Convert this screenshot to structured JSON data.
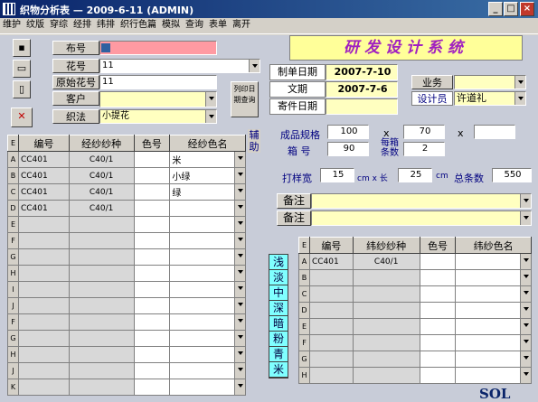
{
  "window": {
    "title": "织物分析表 — 2009-6-11 (ADMIN)"
  },
  "menu": [
    "维护",
    "纹版",
    "穿综",
    "经排",
    "纬排",
    "织行色篇",
    "模拟",
    "查询",
    "表单",
    "离开"
  ],
  "banner": "研发设计系统",
  "form": {
    "cloth_no_label": "布号",
    "cloth_no_value": "",
    "pattern_no_label": "花号",
    "pattern_no_value": "11",
    "orig_pattern_label": "原始花号",
    "orig_pattern_value": "11",
    "customer_label": "客户",
    "customer_value": "",
    "weave_label": "织法",
    "weave_value": "小提花",
    "print_btn": "列印日期查询",
    "make_date_label": "制单日期",
    "make_date_value": "2007-7-10",
    "doc_date_label": "文期",
    "doc_date_value": "2007-7-6",
    "send_date_label": "寄件日期",
    "send_date_value": "",
    "business_label": "业务",
    "business_value": "",
    "designer_label": "设计员",
    "designer_value": "许道礼",
    "spec_label": "成品规格",
    "spec_w": "100",
    "spec_x1": "x",
    "spec_h": "70",
    "spec_x2": "x",
    "spec_extra": "",
    "box_label": "箱  号",
    "box_value": "90",
    "per_box_label": "每箱条数",
    "per_box_value": "2",
    "hit_width_label": "打样宽",
    "hit_width_value": "15",
    "unit_cm_x": "cm x 长",
    "length_value": "25",
    "unit_cm": "cm",
    "total_label": "总条数",
    "total_value": "550",
    "note1_label": "备注",
    "note1_value": "",
    "note2_label": "备注",
    "note2_value": ""
  },
  "warp_table": {
    "corner": "E",
    "headers": [
      "编号",
      "经纱纱种",
      "色号",
      "经纱色名"
    ],
    "rows": [
      {
        "id": "A",
        "no": "CC401",
        "yarn": "C40/1",
        "color": "",
        "name": "米"
      },
      {
        "id": "B",
        "no": "CC401",
        "yarn": "C40/1",
        "color": "",
        "name": "小绿"
      },
      {
        "id": "C",
        "no": "CC401",
        "yarn": "C40/1",
        "color": "",
        "name": "绿"
      },
      {
        "id": "D",
        "no": "CC401",
        "yarn": "C40/1",
        "color": "",
        "name": ""
      },
      {
        "id": "E",
        "no": "",
        "yarn": "",
        "color": "",
        "name": ""
      },
      {
        "id": "F",
        "no": "",
        "yarn": "",
        "color": "",
        "name": ""
      },
      {
        "id": "G",
        "no": "",
        "yarn": "",
        "color": "",
        "name": ""
      },
      {
        "id": "H",
        "no": "",
        "yarn": "",
        "color": "",
        "name": ""
      },
      {
        "id": "I",
        "no": "",
        "yarn": "",
        "color": "",
        "name": ""
      },
      {
        "id": "J",
        "no": "",
        "yarn": "",
        "color": "",
        "name": ""
      },
      {
        "id": "F",
        "no": "",
        "yarn": "",
        "color": "",
        "name": ""
      },
      {
        "id": "G",
        "no": "",
        "yarn": "",
        "color": "",
        "name": ""
      },
      {
        "id": "H",
        "no": "",
        "yarn": "",
        "color": "",
        "name": ""
      },
      {
        "id": "J",
        "no": "",
        "yarn": "",
        "color": "",
        "name": ""
      },
      {
        "id": "K",
        "no": "",
        "yarn": "",
        "color": "",
        "name": ""
      }
    ]
  },
  "aux_label": "辅助",
  "shades": [
    "浅",
    "淡",
    "中",
    "深",
    "暗",
    "粉",
    "青",
    "米"
  ],
  "weft_table": {
    "corner": "E",
    "headers": [
      "编号",
      "纬纱纱种",
      "色号",
      "纬纱色名"
    ],
    "rows": [
      {
        "id": "A",
        "no": "CC401",
        "yarn": "C40/1",
        "color": "",
        "name": ""
      },
      {
        "id": "B",
        "no": "",
        "yarn": "",
        "color": "",
        "name": ""
      },
      {
        "id": "C",
        "no": "",
        "yarn": "",
        "color": "",
        "name": ""
      },
      {
        "id": "D",
        "no": "",
        "yarn": "",
        "color": "",
        "name": ""
      },
      {
        "id": "E",
        "no": "",
        "yarn": "",
        "color": "",
        "name": ""
      },
      {
        "id": "F",
        "no": "",
        "yarn": "",
        "color": "",
        "name": ""
      },
      {
        "id": "G",
        "no": "",
        "yarn": "",
        "color": "",
        "name": ""
      },
      {
        "id": "H",
        "no": "",
        "yarn": "",
        "color": "",
        "name": ""
      }
    ]
  },
  "brand": "SOL"
}
